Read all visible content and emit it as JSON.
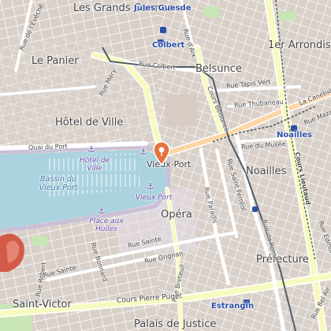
{
  "map": {
    "districts": {
      "grands_carmes": "Les Grands Carmes",
      "panier": "Le Panier",
      "hotel_de_ville": "Hôtel de Ville",
      "vieux_port": "Vieux-Port",
      "opera": "Opéra",
      "noailles": "Noailles",
      "belsunce": "Belsunce",
      "premier": "1er Arrondissement",
      "prefecture": "Préfecture",
      "saint_victor": "Saint-Victor",
      "palais_justice": "Palais de Justice"
    },
    "stations": {
      "jules_guesde": "Jules Guesde",
      "colbert": "Colbert",
      "noailles": "Noailles",
      "estrangin": "Estrangin"
    },
    "water": {
      "bassin": "Bassin du Vieux Port"
    },
    "poi": {
      "hotel_de_ville": "Hôtel de Ville",
      "vieux_port": "Vieux Port",
      "place_huiles": "Place aux Huiles"
    },
    "streets": {
      "mery": "Rue Mery",
      "colbert": "Rue Colbert",
      "cours_belsunce": "Cours Belsunce",
      "tapis_vert": "Rue Tapis Vert",
      "thubaneau": "Rue Thubaneau",
      "canebiere": "La Canebière",
      "mazagran": "Rue Mazagran",
      "musee": "Rue du Musée",
      "lieutaud": "Cours Lieutaud",
      "quai_port": "Quai du Port",
      "saint_ferreol": "Rue Saint Ferréol",
      "paradis": "Rue Paradis",
      "rome": "Rue de Rome",
      "breteuil": "Rue Breteuil",
      "grignan": "Rue Grignan",
      "sainte": "Rue Sainte",
      "pierre_puget": "Cours Pierre Puget",
      "evech": "Rue de l'Évêché",
      "dix": "Rue d'Aix",
      "robert": "Rue Robert",
      "bel_air": "Rue Bel Air",
      "edmond": "Rue Edmond",
      "sainte_victor": "Rue Sainte",
      "bonnard": "Rue Bonnard"
    }
  }
}
